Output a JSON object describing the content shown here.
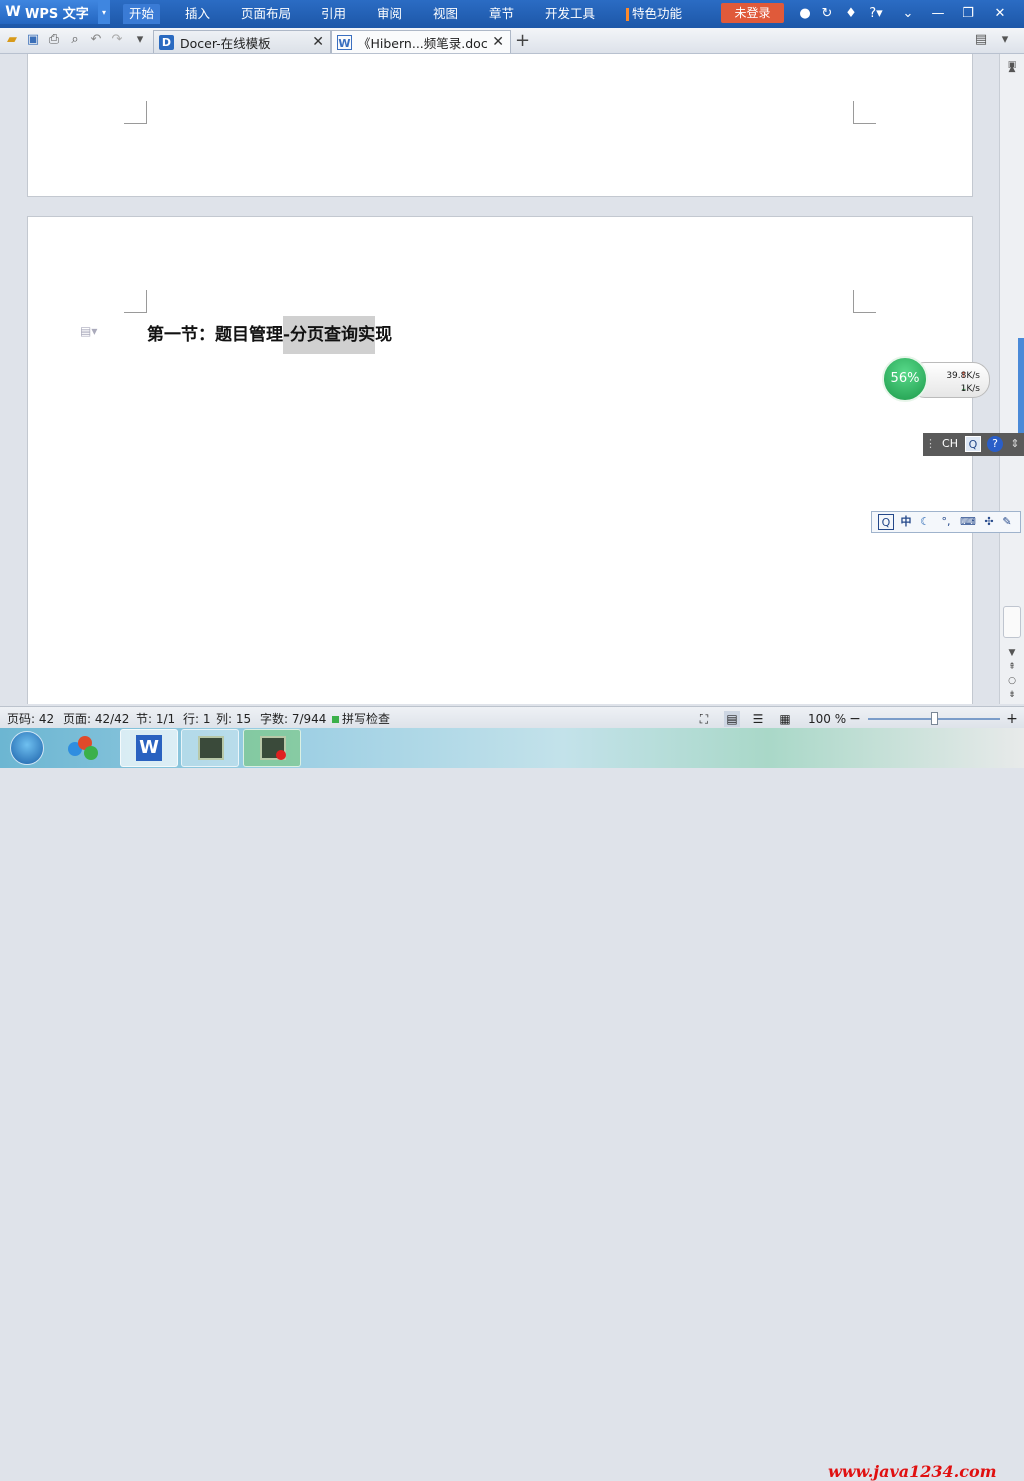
{
  "app": {
    "name": "WPS 文字",
    "logo_glyph": "W",
    "dropdown_glyph": "▾"
  },
  "menu": {
    "items": [
      "开始",
      "插入",
      "页面布局",
      "引用",
      "审阅",
      "视图",
      "章节",
      "开发工具",
      "特色功能"
    ],
    "login_label": "未登录",
    "help_label": "?▾"
  },
  "tabs": [
    {
      "icon_text": "D",
      "label": "Docer-在线模板"
    },
    {
      "icon_text": "W",
      "label": "《Hibern...频笔录.doc"
    }
  ],
  "tab_close_glyph": "✕",
  "new_tab_glyph": "+",
  "document": {
    "heading_plain": "第一节：题目管理",
    "heading_highlight": "-分页查询实",
    "heading_tail": "现"
  },
  "net_widget": {
    "percent": "56%",
    "up_speed": "39.8K/s",
    "down_speed": "1K/s"
  },
  "ime_bar1": {
    "label": "CH"
  },
  "ime_bar2": {
    "label": "中"
  },
  "status": {
    "page_code": "页码: 42",
    "pages": "页面: 42/42",
    "section": "节: 1/1",
    "row": "行: 1",
    "col": "列: 15",
    "words": "字数: 7/944",
    "spell_check": "拼写检查",
    "zoom": "100 %"
  },
  "taskbar": {
    "watermark": "www.java1234.com"
  },
  "colors": {
    "menubar": "#1d57a8",
    "login": "#e05a3a",
    "accent": "#4a8ad8",
    "watermark": "#e01010"
  }
}
